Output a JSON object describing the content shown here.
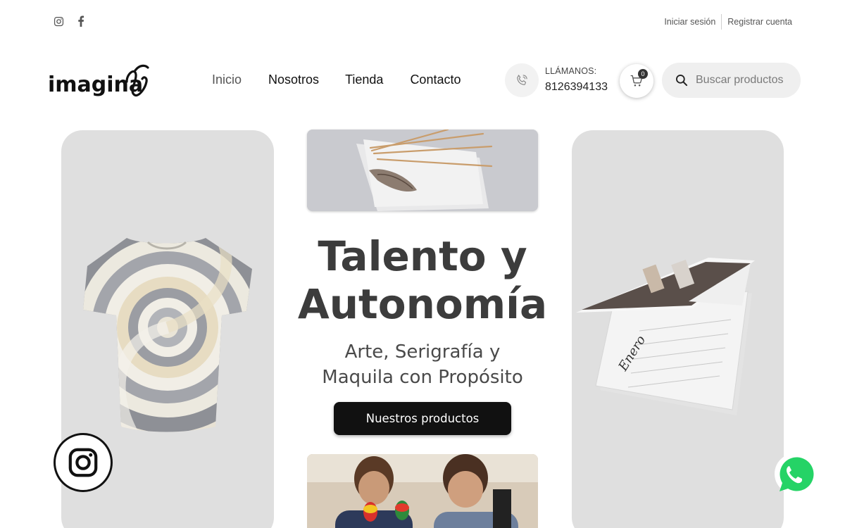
{
  "topbar": {
    "social": [
      {
        "name": "instagram-icon"
      },
      {
        "name": "facebook-icon"
      }
    ],
    "login_label": "Iniciar sesión",
    "register_label": "Registrar cuenta"
  },
  "header": {
    "logo_text": "imagina",
    "nav": [
      {
        "label": "Inicio",
        "active": true
      },
      {
        "label": "Nosotros",
        "active": false
      },
      {
        "label": "Tienda",
        "active": false
      },
      {
        "label": "Contacto",
        "active": false
      }
    ],
    "call_label": "LLÁMANOS:",
    "call_number": "8126394133",
    "cart_count": "0",
    "search_placeholder": "Buscar productos"
  },
  "hero": {
    "title_line1": "Talento y",
    "title_line2": "Autonomía",
    "subtitle_line1": "Arte, Serigrafía y",
    "subtitle_line2": "Maquila con Propósito",
    "button_label": "Nuestros productos"
  },
  "colors": {
    "card_bg": "#dfdfdf",
    "button_bg": "#111111",
    "whatsapp": "#25d366"
  }
}
